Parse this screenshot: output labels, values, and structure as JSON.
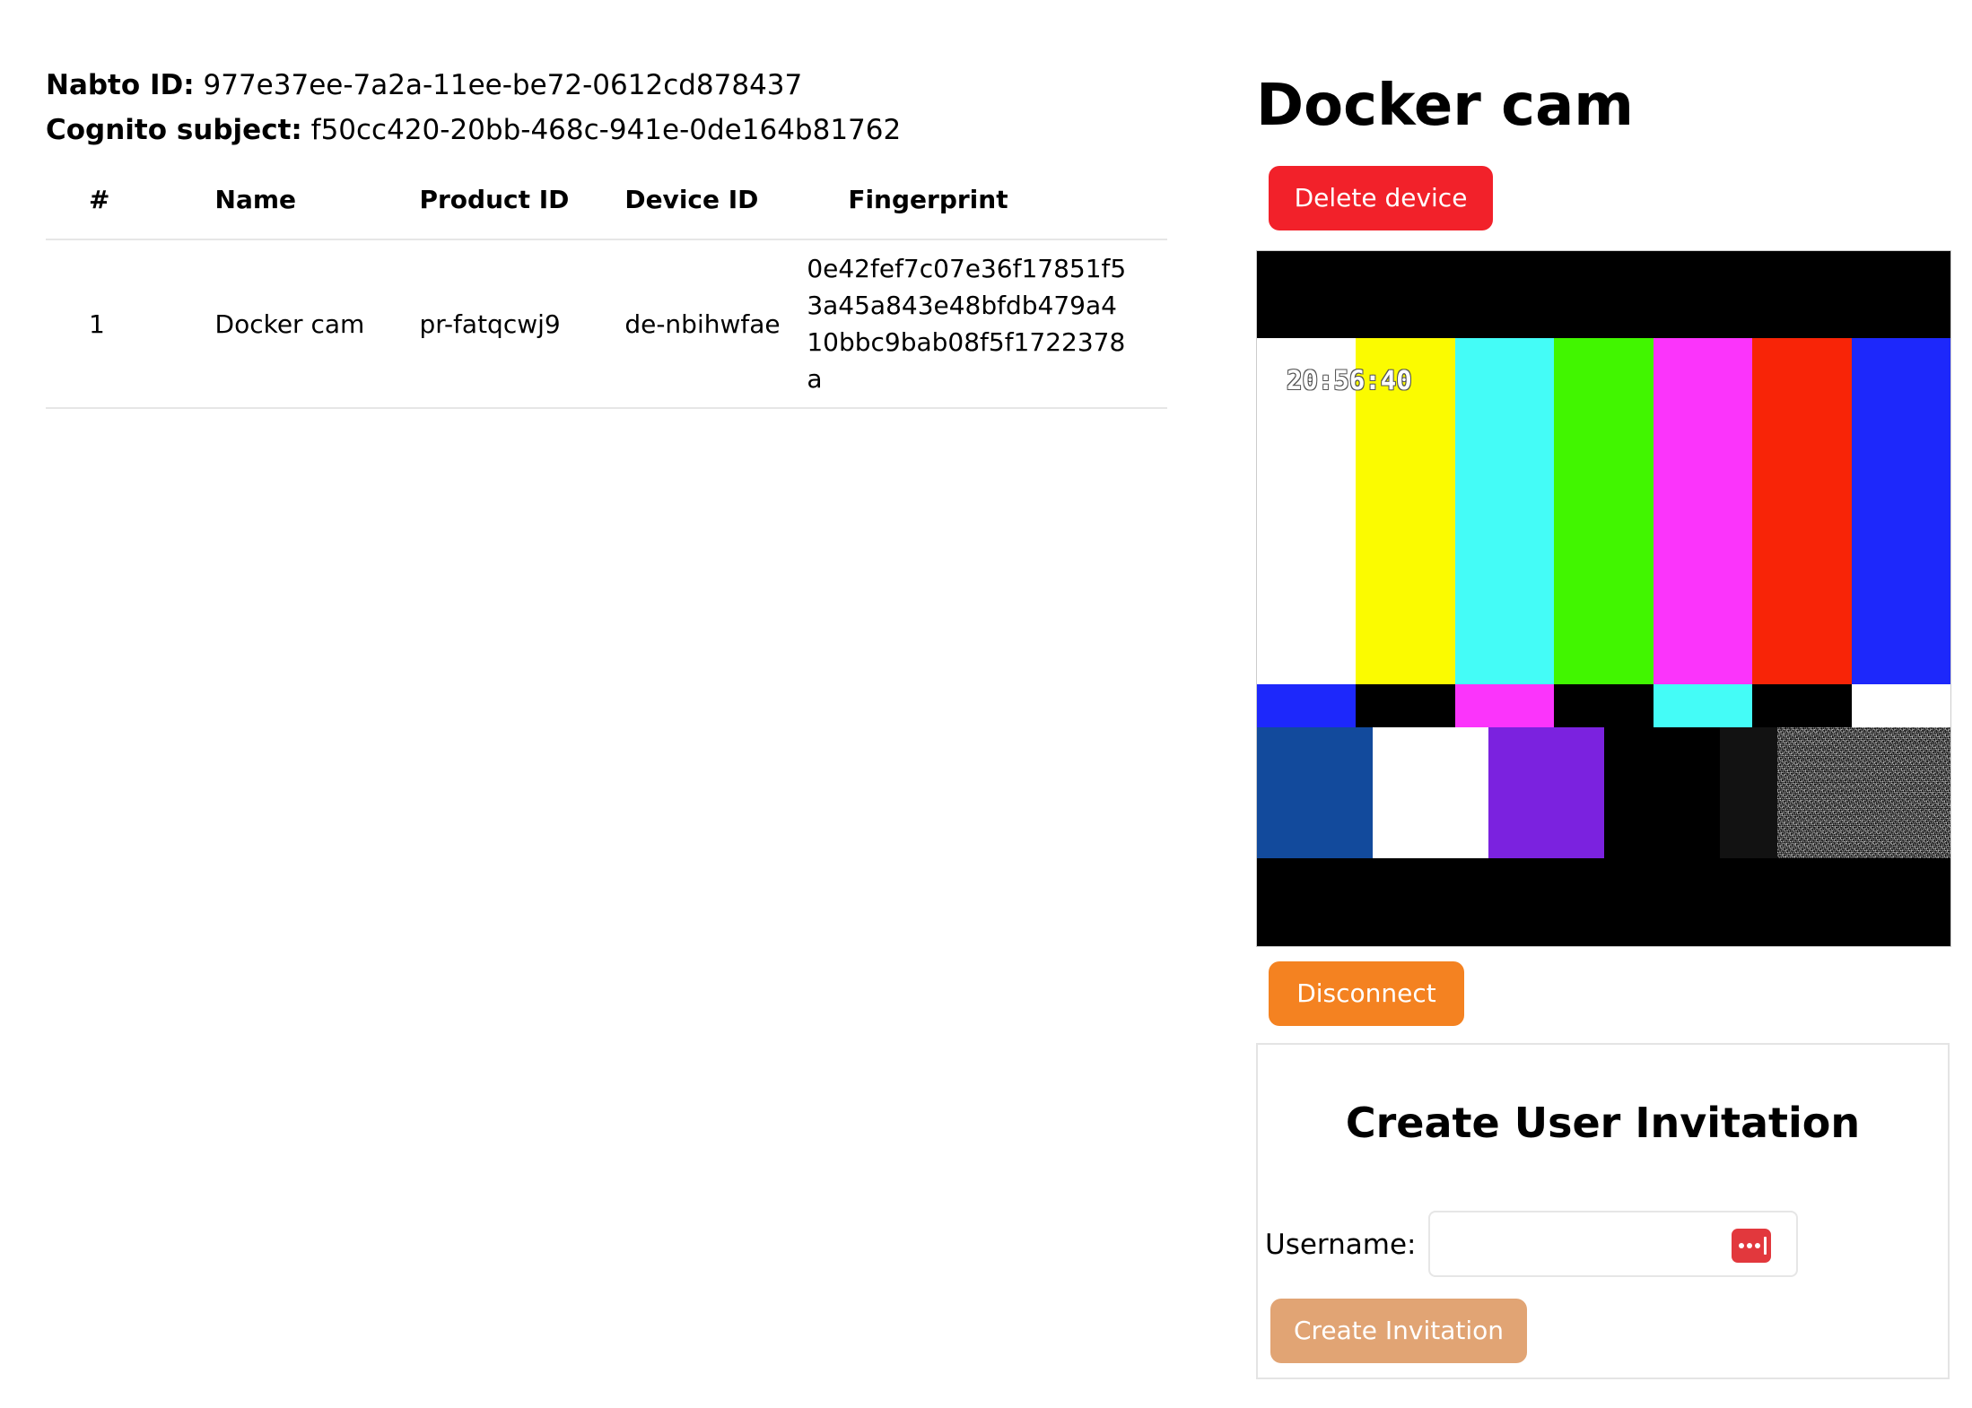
{
  "user": {
    "nabto_label": "Nabto ID:",
    "nabto_id": "977e37ee-7a2a-11ee-be72-0612cd878437",
    "cognito_label": "Cognito subject:",
    "cognito_id": "f50cc420-20bb-468c-941e-0de164b81762"
  },
  "table": {
    "headers": [
      "#",
      "Name",
      "Product ID",
      "Device ID",
      "Fingerprint"
    ],
    "rows": [
      {
        "n": "1",
        "name": "Docker cam",
        "product_id": "pr-fatqcwj9",
        "device_id": "de-nbihwfae",
        "fingerprint": "0e42fef7c07e36f17851f53a45a843e48bfdb479a410bbc9bab08f5f1722378a"
      }
    ]
  },
  "device": {
    "title": "Docker cam",
    "delete_label": "Delete device",
    "disconnect_label": "Disconnect",
    "stream_timestamp": "20:56:40"
  },
  "invitation": {
    "title": "Create User Invitation",
    "username_label": "Username:",
    "username_value": "",
    "create_label": "Create Invitation"
  },
  "colors": {
    "delete": "#f2212a",
    "disconnect": "#f48221",
    "create": "#e1a474",
    "password_manager_icon": "#e2383d"
  },
  "icons": {
    "password_manager": "password-manager-icon"
  }
}
